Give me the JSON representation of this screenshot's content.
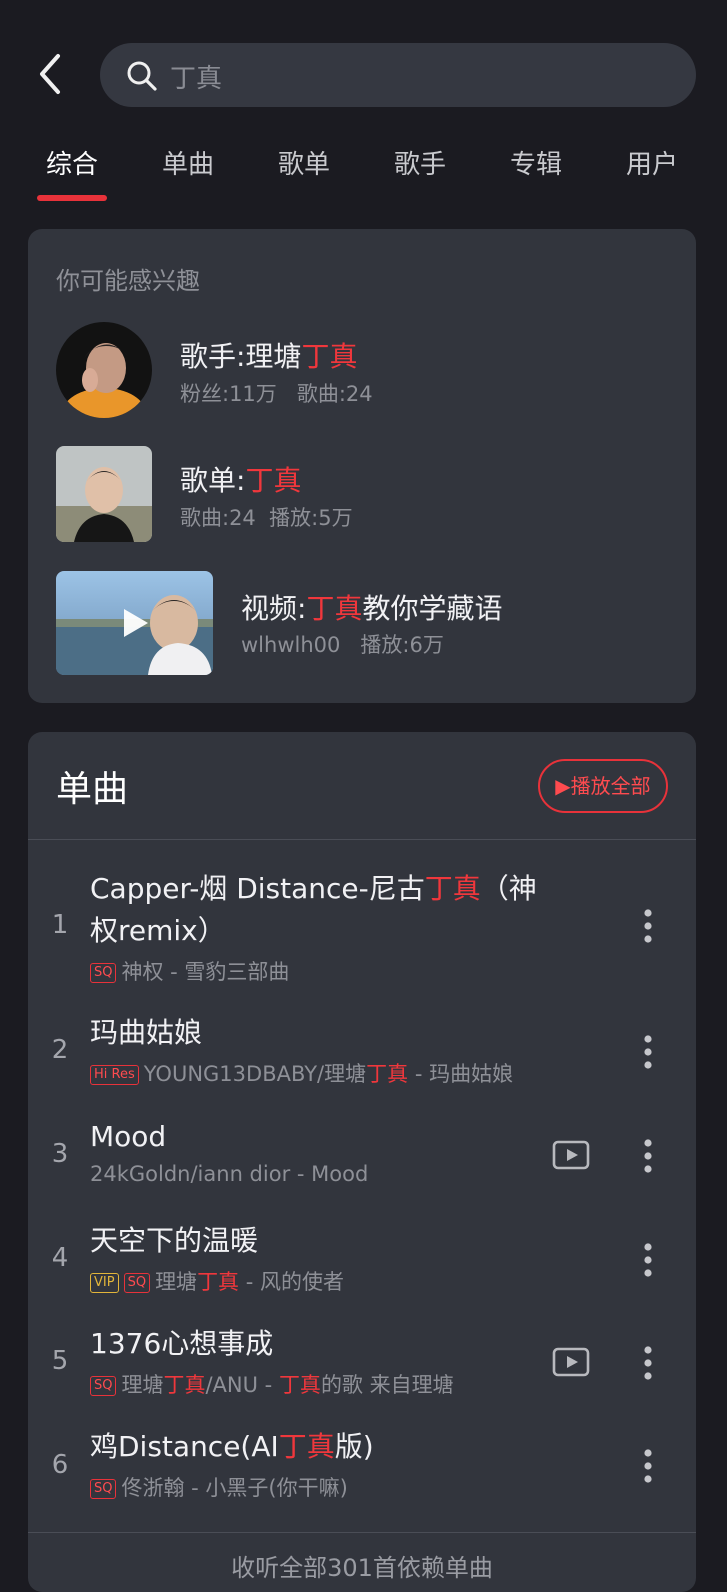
{
  "search": {
    "placeholder": "丁真"
  },
  "tabs": [
    "综合",
    "单曲",
    "歌单",
    "歌手",
    "专辑",
    "用户"
  ],
  "interest": {
    "title": "你可能感兴趣",
    "artist": {
      "prefix": "歌手:理塘",
      "highlight": "丁真",
      "fans": "粉丝:11万",
      "songs": "歌曲:24"
    },
    "playlist": {
      "prefix": "歌单:",
      "highlight": "丁真",
      "songs": "歌曲:24",
      "plays": "播放:5万"
    },
    "video": {
      "prefix": "视频:",
      "highlight": "丁真",
      "suffix": "教你学藏语",
      "uploader": "wlhwlh00",
      "plays": "播放:6万"
    }
  },
  "singles": {
    "title": "单曲",
    "play_all": "▶播放全部",
    "listen_all": "收听全部301首依赖单曲",
    "songs": [
      {
        "num": "1",
        "title_a": "Capper-烟 Distance-尼古",
        "title_hl": "丁真",
        "title_b": "（神权remix）",
        "badges": [
          "SQ"
        ],
        "meta_a": "神权 - 雪豹三部曲"
      },
      {
        "num": "2",
        "title_a": "玛曲姑娘",
        "badges": [
          "Hi Res"
        ],
        "meta_a": "YOUNG13DBABY/理塘",
        "meta_hl": "丁真",
        "meta_b": " - 玛曲姑娘"
      },
      {
        "num": "3",
        "title_a": "Mood",
        "badges": [],
        "meta_a": "24kGoldn/iann dior - Mood"
      },
      {
        "num": "4",
        "title_a": "天空下的温暖",
        "badges": [
          "VIP",
          "SQ"
        ],
        "meta_a": "理塘",
        "meta_hl": "丁真",
        "meta_b": " - 风的使者"
      },
      {
        "num": "5",
        "title_a": "1376心想事成",
        "badges": [
          "SQ"
        ],
        "meta_a": "理塘",
        "meta_hl": "丁真",
        "meta_b": "/ANU - ",
        "meta_hl2": "丁真",
        "meta_c": "的歌 来自理塘"
      },
      {
        "num": "6",
        "title_a": "鸡Distance(AI",
        "title_hl": "丁真",
        "title_b": "版)",
        "badges": [
          "SQ"
        ],
        "meta_a": "佟浙翰 - 小黑子(你干嘛)"
      }
    ]
  },
  "colors": {
    "accent": "#e8323a",
    "background": "#1b1b21",
    "card": "#32353d"
  },
  "icons": [
    "back-icon",
    "search-icon",
    "play-icon",
    "mv-icon",
    "more-icon"
  ]
}
